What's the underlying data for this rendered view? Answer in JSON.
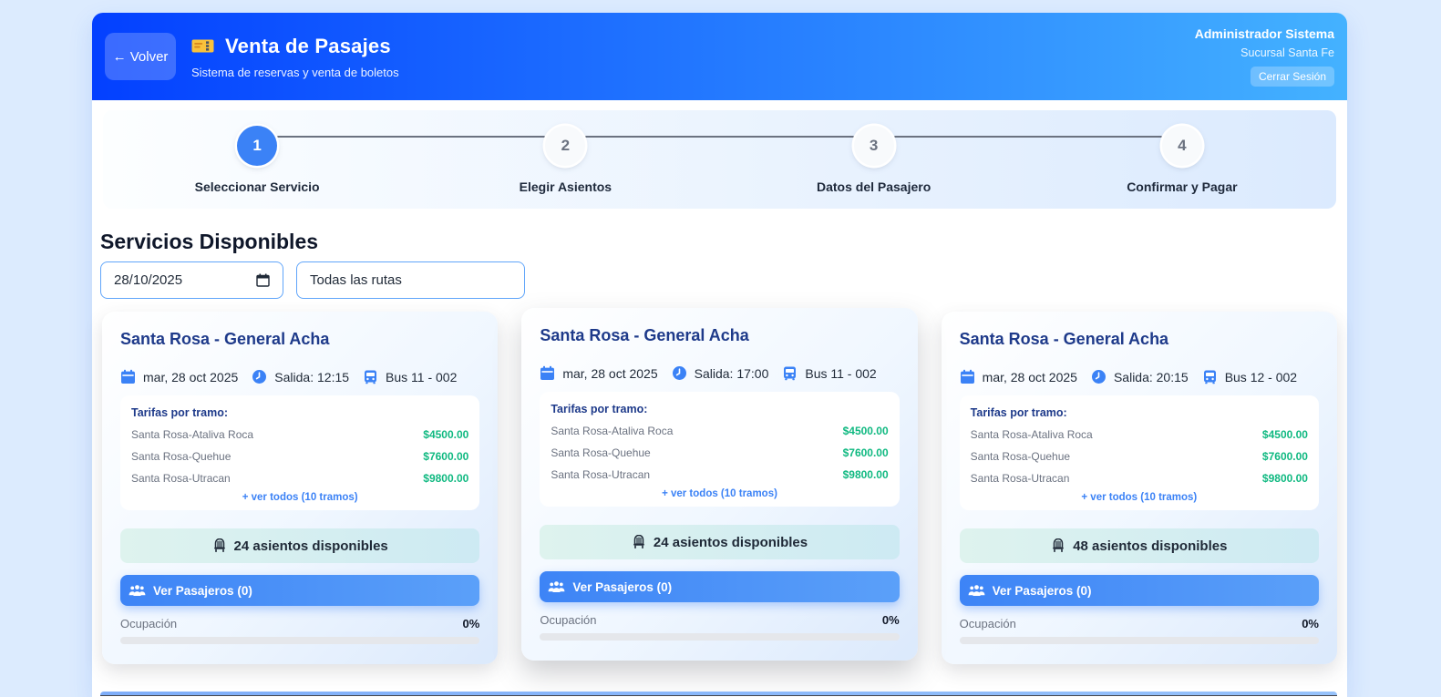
{
  "header": {
    "back_label": "← Volver",
    "title": "Venta de Pasajes",
    "subtitle": "Sistema de reservas y venta de boletos",
    "user_name": "Administrador Sistema",
    "branch": "Sucursal Santa Fe",
    "logout_label": "Cerrar Sesión"
  },
  "stepper": {
    "steps": [
      {
        "num": "1",
        "label": "Seleccionar Servicio"
      },
      {
        "num": "2",
        "label": "Elegir Asientos"
      },
      {
        "num": "3",
        "label": "Datos del Pasajero"
      },
      {
        "num": "4",
        "label": "Confirmar y Pagar"
      }
    ]
  },
  "services": {
    "heading": "Servicios Disponibles",
    "date_value": "28/10/2025",
    "route_filter": "Todas las rutas"
  },
  "colors": {
    "page_background": "#dcebfe",
    "header_gradient_start": "#0340ff",
    "header_gradient_end": "#44b2ff",
    "accent_blue": "#3b82f6",
    "step_inactive_text": "#6b7280",
    "price_green": "#10b981",
    "title_navy": "#1e3a8a",
    "button_gradient_start": "#3d84f6",
    "button_gradient_end": "#5ba0f9"
  },
  "cards": [
    {
      "route": "Santa Rosa - General Acha",
      "date": "mar, 28 oct 2025",
      "departure": "Salida: 12:15",
      "bus": "Bus 11 - 002",
      "fares_title": "Tarifas por tramo:",
      "fares": [
        {
          "name": "Santa Rosa-Ataliva Roca",
          "price": "$4500.00"
        },
        {
          "name": "Santa Rosa-Quehue",
          "price": "$7600.00"
        },
        {
          "name": "Santa Rosa-Utracan",
          "price": "$9800.00"
        }
      ],
      "more_link": "+ ver todos (10 tramos)",
      "seats": "24 asientos disponibles",
      "passengers_button": "Ver Pasajeros (0)",
      "occupancy_label": "Ocupación",
      "occupancy_value": "0%",
      "featured": false
    },
    {
      "route": "Santa Rosa - General Acha",
      "date": "mar, 28 oct 2025",
      "departure": "Salida: 17:00",
      "bus": "Bus 11 - 002",
      "fares_title": "Tarifas por tramo:",
      "fares": [
        {
          "name": "Santa Rosa-Ataliva Roca",
          "price": "$4500.00"
        },
        {
          "name": "Santa Rosa-Quehue",
          "price": "$7600.00"
        },
        {
          "name": "Santa Rosa-Utracan",
          "price": "$9800.00"
        }
      ],
      "more_link": "+ ver todos (10 tramos)",
      "seats": "24 asientos disponibles",
      "passengers_button": "Ver Pasajeros (0)",
      "occupancy_label": "Ocupación",
      "occupancy_value": "0%",
      "featured": true
    },
    {
      "route": "Santa Rosa - General Acha",
      "date": "mar, 28 oct 2025",
      "departure": "Salida: 20:15",
      "bus": "Bus 12 - 002",
      "fares_title": "Tarifas por tramo:",
      "fares": [
        {
          "name": "Santa Rosa-Ataliva Roca",
          "price": "$4500.00"
        },
        {
          "name": "Santa Rosa-Quehue",
          "price": "$7600.00"
        },
        {
          "name": "Santa Rosa-Utracan",
          "price": "$9800.00"
        }
      ],
      "more_link": "+ ver todos (10 tramos)",
      "seats": "48 asientos disponibles",
      "passengers_button": "Ver Pasajeros (0)",
      "occupancy_label": "Ocupación",
      "occupancy_value": "0%",
      "featured": false
    }
  ]
}
